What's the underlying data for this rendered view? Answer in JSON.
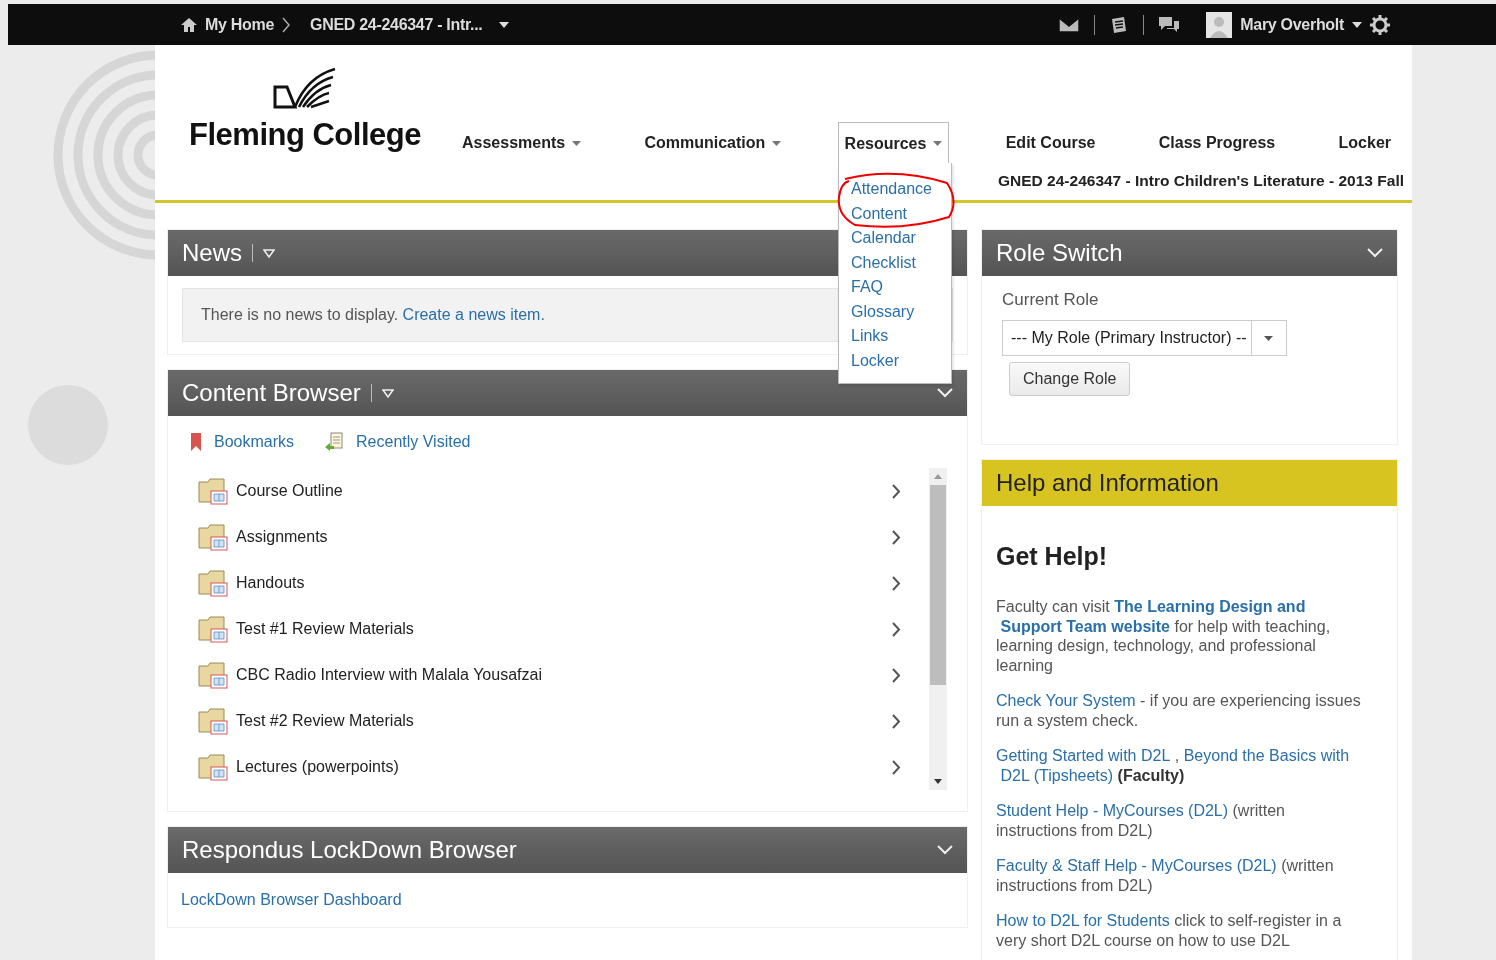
{
  "top_bar": {
    "home": "My Home",
    "course": "GNED 24-246347 - Intr...",
    "user": "Mary Overholt"
  },
  "logo": {
    "text": "Fleming College"
  },
  "nav": [
    {
      "label": "Assessments",
      "dropdown": true,
      "selected": false
    },
    {
      "label": "Communication",
      "dropdown": true,
      "selected": false
    },
    {
      "label": "Resources",
      "dropdown": true,
      "selected": true
    },
    {
      "label": "Edit Course",
      "dropdown": false,
      "selected": false
    },
    {
      "label": "Class Progress",
      "dropdown": false,
      "selected": false
    },
    {
      "label": "Locker",
      "dropdown": false,
      "selected": false
    }
  ],
  "course_title": "GNED 24-246347 - Intro Children's Literature - 2013 Fall",
  "resources_menu": [
    "Attendance",
    "Content",
    "Calendar",
    "Checklist",
    "FAQ",
    "Glossary",
    "Links",
    "Locker"
  ],
  "news": {
    "title": "News",
    "message": "There is no news to display.",
    "link": "Create a news item."
  },
  "content_browser": {
    "title": "Content Browser",
    "bookmarks": "Bookmarks",
    "recent": "Recently Visited",
    "items": [
      "Course Outline",
      "Assignments",
      "Handouts",
      "Test #1 Review Materials",
      "CBC Radio Interview with Malala Yousafzai",
      "Test #2 Review Materials",
      "Lectures (powerpoints)"
    ]
  },
  "lockdown": {
    "title": "Respondus LockDown Browser",
    "link": "LockDown Browser Dashboard"
  },
  "role_switch": {
    "title": "Role Switch",
    "label": "Current Role",
    "value": "--- My Role (Primary Instructor) --",
    "button": "Change Role"
  },
  "help": {
    "title": "Help and Information",
    "heading": "Get Help!",
    "paragraphs": [
      [
        {
          "text": "Faculty can visit ",
          "kind": "plain"
        },
        {
          "text": "The Learning Design and",
          "kind": "strong-link"
        },
        {
          "text": "Support Team website",
          "kind": "strong-link",
          "spaced": true
        },
        {
          "text": " for help with teaching, learning design, technology, and professional learning",
          "kind": "plain"
        }
      ],
      [
        {
          "text": "Check Your System",
          "kind": "link"
        },
        {
          "text": " - if you are experiencing issues run a system check.",
          "kind": "plain"
        }
      ],
      [
        {
          "text": "Getting Started with D2L",
          "kind": "link"
        },
        {
          "text": " , ",
          "kind": "plain"
        },
        {
          "text": "Beyond the Basics with",
          "kind": "link"
        },
        {
          "text": "D2L (Tipsheets)",
          "kind": "link",
          "spaced": true
        },
        {
          "text": " (Faculty)",
          "kind": "bold"
        }
      ],
      [
        {
          "text": "Student Help - MyCourses (D2L)",
          "kind": "link"
        },
        {
          "text": " (written instructions from D2L)",
          "kind": "plain"
        }
      ],
      [
        {
          "text": "Faculty & Staff Help - MyCourses (D2L)",
          "kind": "link"
        },
        {
          "text": " (written instructions from D2L)",
          "kind": "plain"
        }
      ],
      [
        {
          "text": "How to D2L for Students",
          "kind": "link"
        },
        {
          "text": " click to self-register in a very short D2L course on how to use D2L",
          "kind": "plain"
        }
      ]
    ]
  }
}
